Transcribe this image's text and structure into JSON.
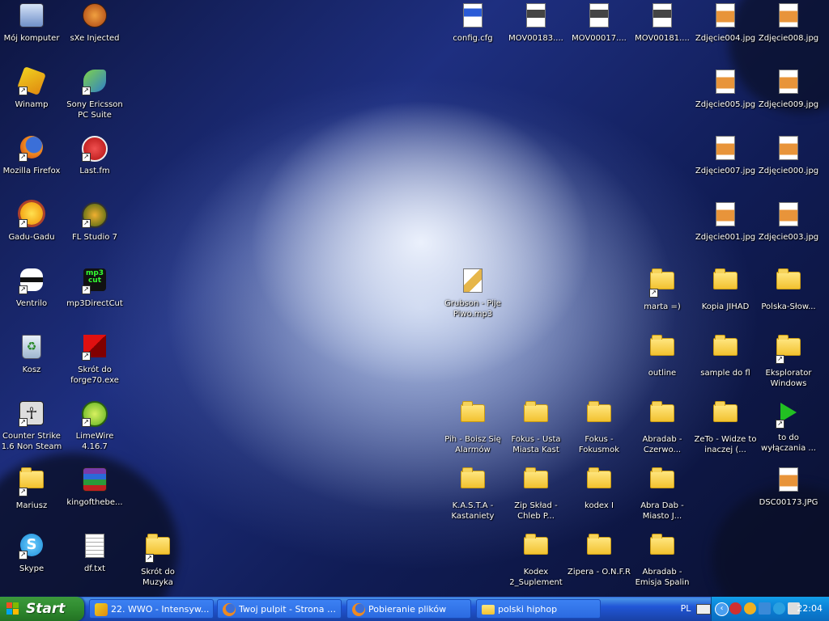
{
  "desktop": {
    "icons": [
      {
        "id": "moj-komputer",
        "label": "Mój komputer",
        "icon": "computer-icon",
        "shortcut": false
      },
      {
        "id": "sxe",
        "label": "sXe Injected",
        "icon": "sxe-icon",
        "shortcut": false
      },
      {
        "id": "winamp",
        "label": "Winamp",
        "icon": "winamp-icon",
        "shortcut": true
      },
      {
        "id": "sony",
        "label": "Sony Ericsson PC Suite",
        "icon": "phone-suite-icon",
        "shortcut": true
      },
      {
        "id": "firefox",
        "label": "Mozilla Firefox",
        "icon": "firefox-icon",
        "shortcut": true
      },
      {
        "id": "lastfm",
        "label": "Last.fm",
        "icon": "lastfm-icon",
        "shortcut": true
      },
      {
        "id": "gadu",
        "label": "Gadu-Gadu",
        "icon": "gadu-icon",
        "shortcut": true
      },
      {
        "id": "fl",
        "label": "FL Studio 7",
        "icon": "fl-studio-icon",
        "shortcut": true
      },
      {
        "id": "ventrilo",
        "label": "Ventrilo",
        "icon": "ventrilo-icon",
        "shortcut": true
      },
      {
        "id": "mp3dc",
        "label": "mp3DirectCut",
        "icon": "mp3directcut-icon",
        "shortcut": true
      },
      {
        "id": "kosz",
        "label": "Kosz",
        "icon": "recycle-bin-icon",
        "shortcut": false
      },
      {
        "id": "forge",
        "label": "Skrót do forge70.exe",
        "icon": "forge-icon",
        "shortcut": true
      },
      {
        "id": "cs",
        "label": "Counter Strike 1.6 Non Steam",
        "icon": "counter-strike-icon",
        "shortcut": true
      },
      {
        "id": "limewire",
        "label": "LimeWire 4.16.7",
        "icon": "limewire-icon",
        "shortcut": true
      },
      {
        "id": "mariusz",
        "label": "Mariusz",
        "icon": "folder-icon",
        "shortcut": true
      },
      {
        "id": "kingofthebe",
        "label": "kingofthebe...",
        "icon": "winrar-icon",
        "shortcut": false
      },
      {
        "id": "skype",
        "label": "Skype",
        "icon": "skype-icon",
        "shortcut": true
      },
      {
        "id": "dftxt",
        "label": "df.txt",
        "icon": "text-file-icon",
        "shortcut": false
      },
      {
        "id": "muzyka",
        "label": "Skrót do Muzyka",
        "icon": "folder-icon",
        "shortcut": true
      },
      {
        "id": "config",
        "label": "config.cfg",
        "icon": "config-file-icon",
        "shortcut": false
      },
      {
        "id": "mov183",
        "label": "MOV00183....",
        "icon": "video-file-icon",
        "shortcut": false
      },
      {
        "id": "mov17",
        "label": "MOV00017....",
        "icon": "video-file-icon",
        "shortcut": false
      },
      {
        "id": "mov181",
        "label": "MOV00181....",
        "icon": "video-file-icon",
        "shortcut": false
      },
      {
        "id": "z004",
        "label": "Zdjęcie004.jpg",
        "icon": "image-file-icon",
        "shortcut": false
      },
      {
        "id": "z008",
        "label": "Zdjęcie008.jpg",
        "icon": "image-file-icon",
        "shortcut": false
      },
      {
        "id": "z005",
        "label": "Zdjęcie005.jpg",
        "icon": "image-file-icon",
        "shortcut": false
      },
      {
        "id": "z009",
        "label": "Zdjęcie009.jpg",
        "icon": "image-file-icon",
        "shortcut": false
      },
      {
        "id": "z007",
        "label": "Zdjęcie007.jpg",
        "icon": "image-file-icon",
        "shortcut": false
      },
      {
        "id": "z000",
        "label": "Zdjęcie000.jpg",
        "icon": "image-file-icon",
        "shortcut": false
      },
      {
        "id": "z001",
        "label": "Zdjęcie001.jpg",
        "icon": "image-file-icon",
        "shortcut": false
      },
      {
        "id": "z003",
        "label": "Zdjęcie003.jpg",
        "icon": "image-file-icon",
        "shortcut": false
      },
      {
        "id": "grubson",
        "label": "Grubson - Pije Piwo.mp3",
        "icon": "audio-file-icon",
        "shortcut": false
      },
      {
        "id": "marta",
        "label": "marta =)",
        "icon": "folder-icon",
        "shortcut": true
      },
      {
        "id": "kopia",
        "label": "Kopia JIHAD",
        "icon": "folder-icon",
        "shortcut": false
      },
      {
        "id": "polska",
        "label": "Polska-Słow...",
        "icon": "folder-icon",
        "shortcut": false
      },
      {
        "id": "outline",
        "label": "outline",
        "icon": "folder-icon",
        "shortcut": false
      },
      {
        "id": "sample",
        "label": "sample do fl",
        "icon": "folder-icon",
        "shortcut": false
      },
      {
        "id": "eksplorator",
        "label": "Eksplorator Windows",
        "icon": "explorer-icon",
        "shortcut": true
      },
      {
        "id": "pih",
        "label": "Pih - Boisz Się Alarmów",
        "icon": "folder-icon",
        "shortcut": false
      },
      {
        "id": "fokus1",
        "label": "Fokus - Usta Miasta Kast",
        "icon": "folder-icon",
        "shortcut": false
      },
      {
        "id": "fokus2",
        "label": "Fokus - Fokusmok",
        "icon": "folder-icon",
        "shortcut": false
      },
      {
        "id": "abradab1",
        "label": "Abradab - Czerwo...",
        "icon": "folder-icon",
        "shortcut": false
      },
      {
        "id": "zeto",
        "label": "ZeTo - Widze to inaczej (...",
        "icon": "folder-icon",
        "shortcut": false
      },
      {
        "id": "todo",
        "label": "to do wyłączania ...",
        "icon": "play-arrow-icon",
        "shortcut": true
      },
      {
        "id": "kasta",
        "label": "K.A.S.T.A - Kastaniety",
        "icon": "folder-icon",
        "shortcut": false
      },
      {
        "id": "zip",
        "label": "Zip Skład - Chleb P...",
        "icon": "folder-icon",
        "shortcut": false
      },
      {
        "id": "kodex",
        "label": "kodex I",
        "icon": "folder-icon",
        "shortcut": false
      },
      {
        "id": "abradab2",
        "label": "Abra Dab - Miasto J...",
        "icon": "folder-icon",
        "shortcut": false
      },
      {
        "id": "dsc",
        "label": "DSC00173.JPG",
        "icon": "image-file-icon",
        "shortcut": false
      },
      {
        "id": "kodex2",
        "label": "Kodex 2_Suplement",
        "icon": "folder-icon",
        "shortcut": false
      },
      {
        "id": "zipera",
        "label": "Zipera - O.N.F.R",
        "icon": "folder-icon",
        "shortcut": false
      },
      {
        "id": "abradab3",
        "label": "Abradab - Emisja Spalin",
        "icon": "folder-icon",
        "shortcut": false
      }
    ]
  },
  "taskbar": {
    "start_label": "Start",
    "tasks": [
      {
        "label": "22. WWO - Intensyw...",
        "icon": "winamp-icon"
      },
      {
        "label": "Twoj pulpit - Strona 1...",
        "icon": "firefox-icon"
      },
      {
        "label": "Pobieranie plików",
        "icon": "firefox-icon"
      },
      {
        "label": "polski hiphop",
        "icon": "folder-icon"
      }
    ],
    "language": "PL",
    "clock": "22:04"
  }
}
